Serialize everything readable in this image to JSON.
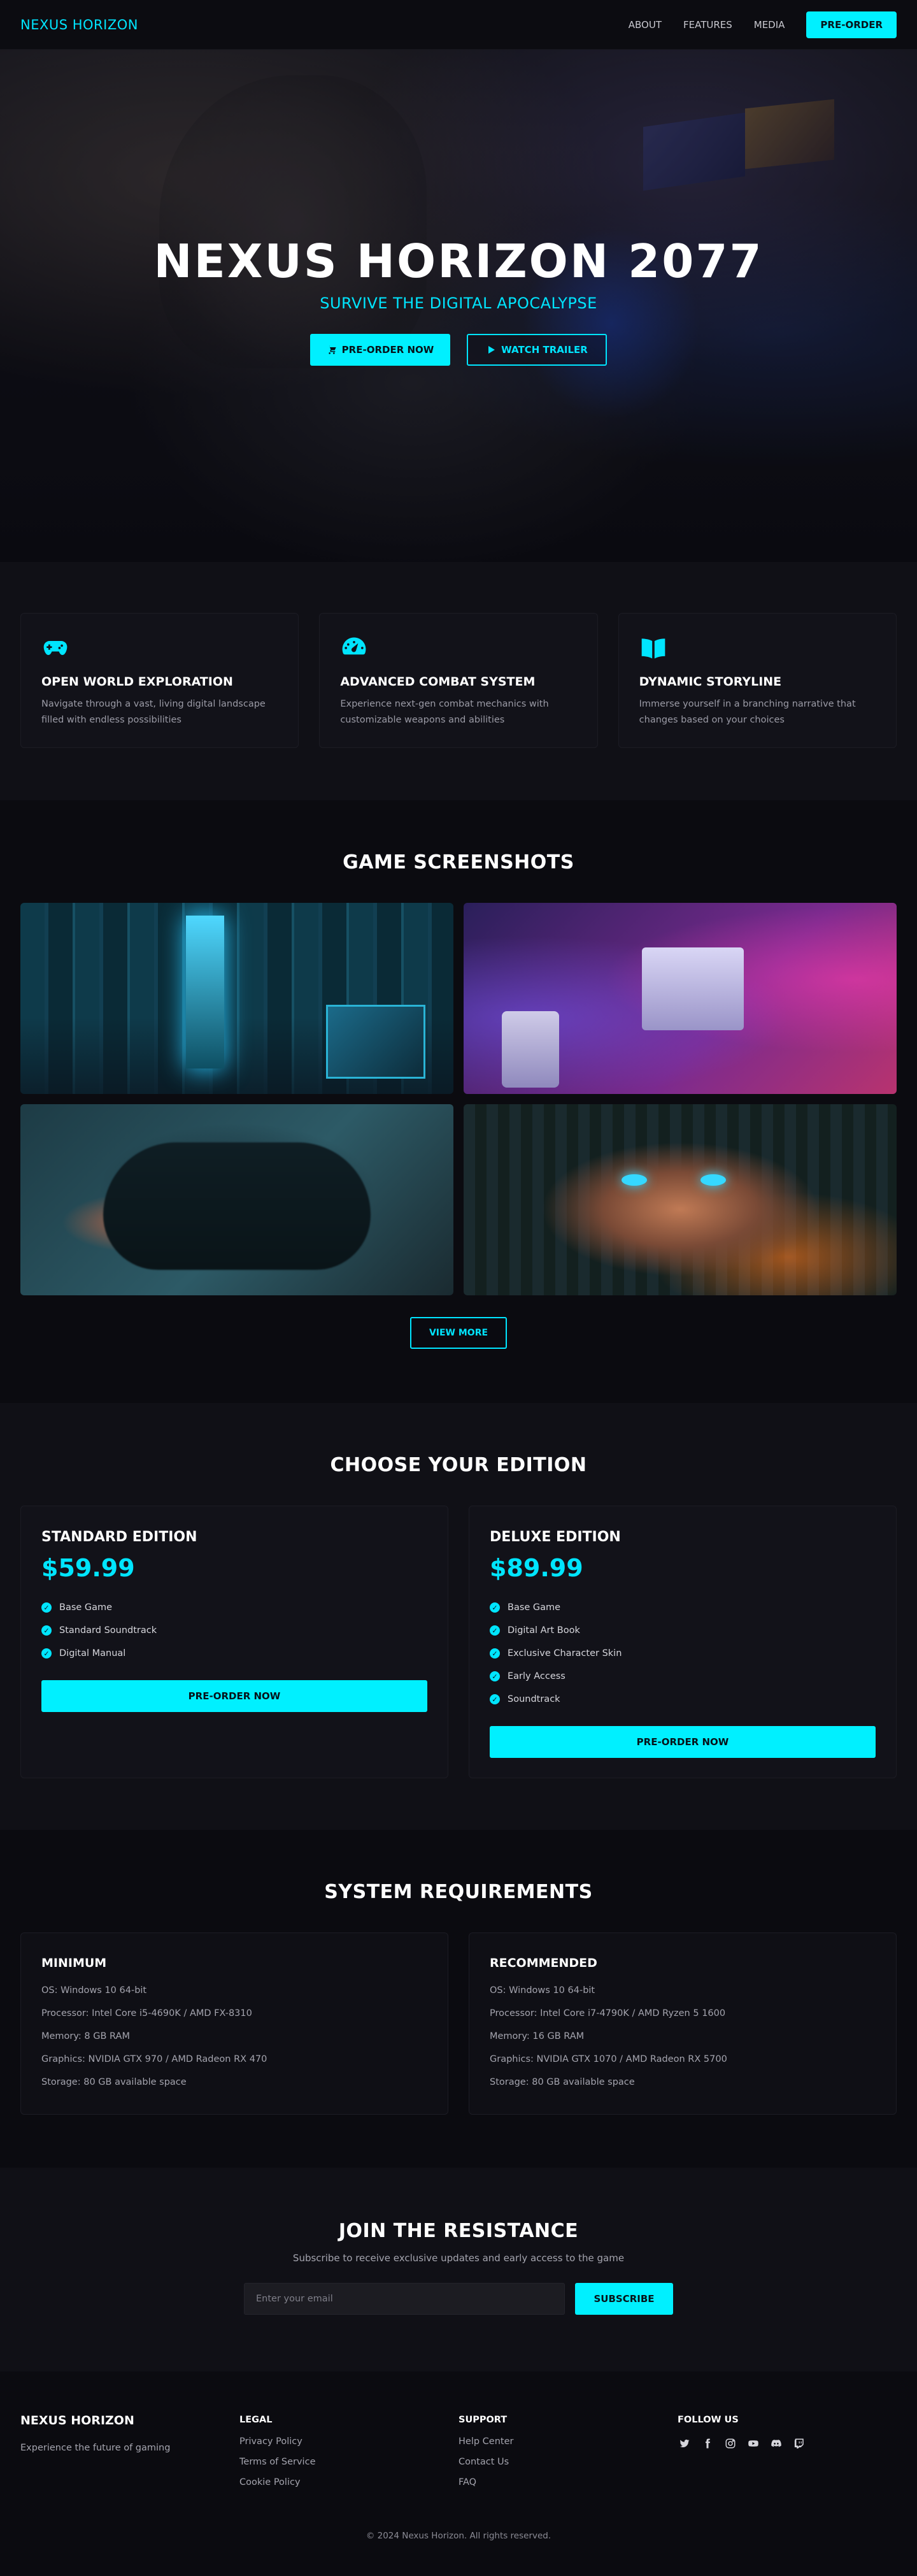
{
  "nav": {
    "brand": "NEXUS HORIZON",
    "links": [
      "ABOUT",
      "FEATURES",
      "MEDIA"
    ],
    "cta": "PRE-ORDER"
  },
  "hero": {
    "title": "NEXUS HORIZON 2077",
    "subtitle": "SURVIVE THE DIGITAL APOCALYPSE",
    "primary_button": "PRE-ORDER NOW",
    "secondary_button": "WATCH TRAILER"
  },
  "features": [
    {
      "icon": "gamepad-icon",
      "title": "OPEN WORLD EXPLORATION",
      "description": "Navigate through a vast, living digital landscape filled with endless possibilities"
    },
    {
      "icon": "gauge-icon",
      "title": "ADVANCED COMBAT SYSTEM",
      "description": "Experience next-gen combat mechanics with customizable weapons and abilities"
    },
    {
      "icon": "book-icon",
      "title": "DYNAMIC STORYLINE",
      "description": "Immerse yourself in a branching narrative that changes based on your choices"
    }
  ],
  "screenshots": {
    "title": "GAME SCREENSHOTS",
    "view_more": "VIEW MORE"
  },
  "editions": {
    "title": "CHOOSE YOUR EDITION",
    "cards": [
      {
        "name": "STANDARD EDITION",
        "price": "$59.99",
        "items": [
          "Base Game",
          "Standard Soundtrack",
          "Digital Manual"
        ],
        "button": "PRE-ORDER NOW"
      },
      {
        "name": "DELUXE EDITION",
        "price": "$89.99",
        "items": [
          "Base Game",
          "Digital Art Book",
          "Exclusive Character Skin",
          "Early Access",
          "Soundtrack"
        ],
        "button": "PRE-ORDER NOW"
      }
    ]
  },
  "requirements": {
    "title": "SYSTEM REQUIREMENTS",
    "minimum": {
      "title": "MINIMUM",
      "items": [
        "OS: Windows 10 64-bit",
        "Processor: Intel Core i5-4690K / AMD FX-8310",
        "Memory: 8 GB RAM",
        "Graphics: NVIDIA GTX 970 / AMD Radeon RX 470",
        "Storage: 80 GB available space"
      ]
    },
    "recommended": {
      "title": "RECOMMENDED",
      "items": [
        "OS: Windows 10 64-bit",
        "Processor: Intel Core i7-4790K / AMD Ryzen 5 1600",
        "Memory: 16 GB RAM",
        "Graphics: NVIDIA GTX 1070 / AMD Radeon RX 5700",
        "Storage: 80 GB available space"
      ]
    }
  },
  "newsletter": {
    "title": "JOIN THE RESISTANCE",
    "subtitle": "Subscribe to receive exclusive updates and early access to the game",
    "placeholder": "Enter your email",
    "button": "SUBSCRIBE"
  },
  "footer": {
    "brand": "NEXUS HORIZON",
    "tagline": "Experience the future of gaming",
    "legal": {
      "title": "LEGAL",
      "links": [
        "Privacy Policy",
        "Terms of Service",
        "Cookie Policy"
      ]
    },
    "support": {
      "title": "SUPPORT",
      "links": [
        "Help Center",
        "Contact Us",
        "FAQ"
      ]
    },
    "follow": {
      "title": "FOLLOW US",
      "icons": [
        "twitter-icon",
        "facebook-icon",
        "instagram-icon",
        "youtube-icon",
        "discord-icon",
        "twitch-icon"
      ]
    },
    "copyright": "© 2024 Nexus Horizon. All rights reserved."
  },
  "colors": {
    "accent": "#00f0ff",
    "background": "#0d0d12"
  }
}
